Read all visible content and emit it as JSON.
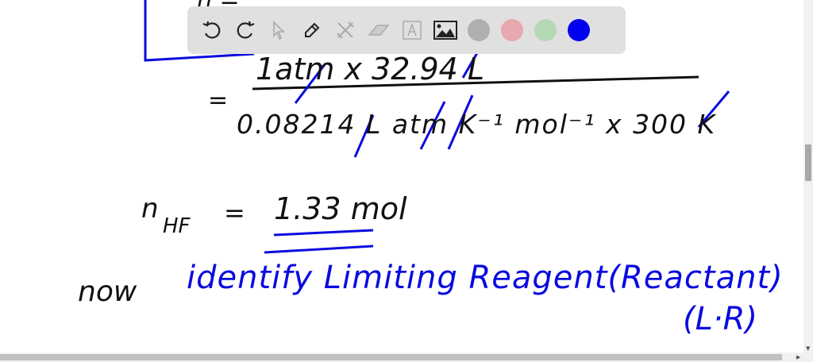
{
  "toolbar": {
    "tools": [
      "undo-icon",
      "redo-icon",
      "select-icon",
      "pen-icon",
      "tools-icon",
      "eraser-icon",
      "text-icon",
      "image-icon"
    ],
    "colors": [
      "#b0b0b0",
      "#e8a8b0",
      "#b4d8b4",
      "#0000ee"
    ]
  },
  "board": {
    "top_partial": "n =",
    "eq_prefix": "=",
    "numerator": "1atm x 32.94 L",
    "denominator": "0.08214 L atm K⁻¹ mol⁻¹ x 300 K",
    "n_label": "n",
    "n_sub": "HF",
    "n_eq": "=",
    "n_value": "1.33 mol",
    "now": "now",
    "identify": "identify Limiting Reagent(Reactant)",
    "abbrev": "(L·R)"
  },
  "ink_colors": {
    "black": "#111111",
    "blue": "#0a0ae0"
  }
}
